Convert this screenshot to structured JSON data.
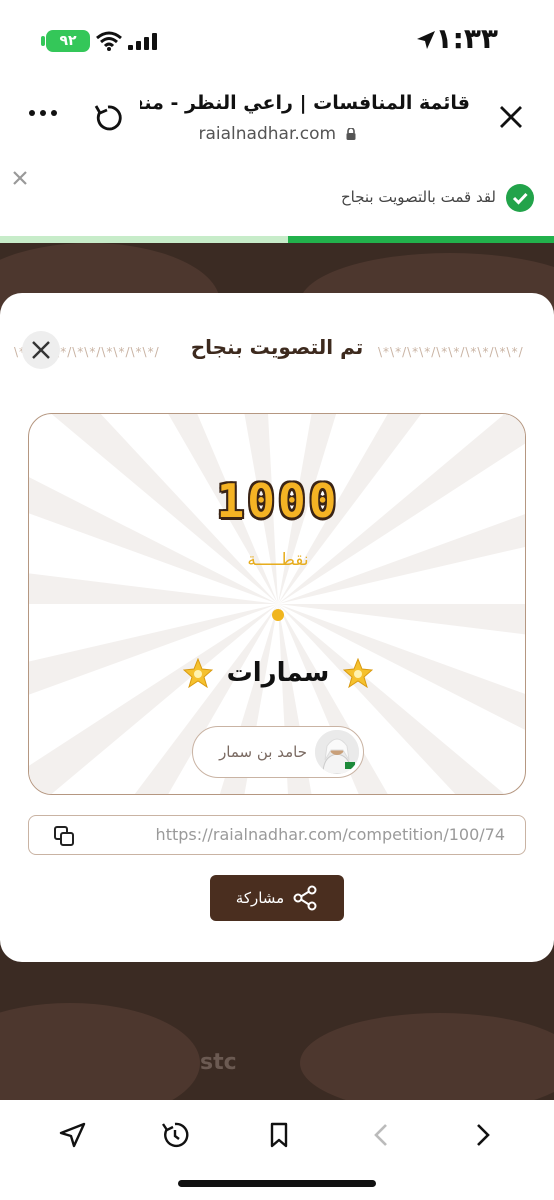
{
  "status_bar": {
    "time": "١:٣٣",
    "battery": "٩٢",
    "icons": [
      "location-arrow-icon",
      "wifi-icon",
      "cellular-signal-icon",
      "battery-icon"
    ]
  },
  "browser": {
    "title": "قائمة المنافسات | راعي النظر - منقية...",
    "url": "raialnadhar.com",
    "icons": [
      "close-icon",
      "reload-icon",
      "more-icon",
      "lock-icon"
    ]
  },
  "notification": {
    "text": "لقد قمت بالتصويت بنجاح",
    "progress": 0.48,
    "icons": [
      "check-icon",
      "dismiss-icon"
    ]
  },
  "background_footer": {
    "brands": [
      "stc"
    ]
  },
  "modal": {
    "title": "تم التصويت بنجاح",
    "decoration": "\\*\\*/\\*\\*/\\*\\*/\\*\\*/\\*\\*/",
    "card": {
      "points": "1000",
      "points_label": "نقطـــــة",
      "entry_name": "سمارات",
      "voter_name": "حامد بن سمار"
    },
    "share_url": "https://raialnadhar.com/competition/100/74",
    "share_label": "مشاركة"
  },
  "colors": {
    "accent": "#4a2e1f",
    "gold": "#f5b324",
    "success": "#22a34a"
  }
}
